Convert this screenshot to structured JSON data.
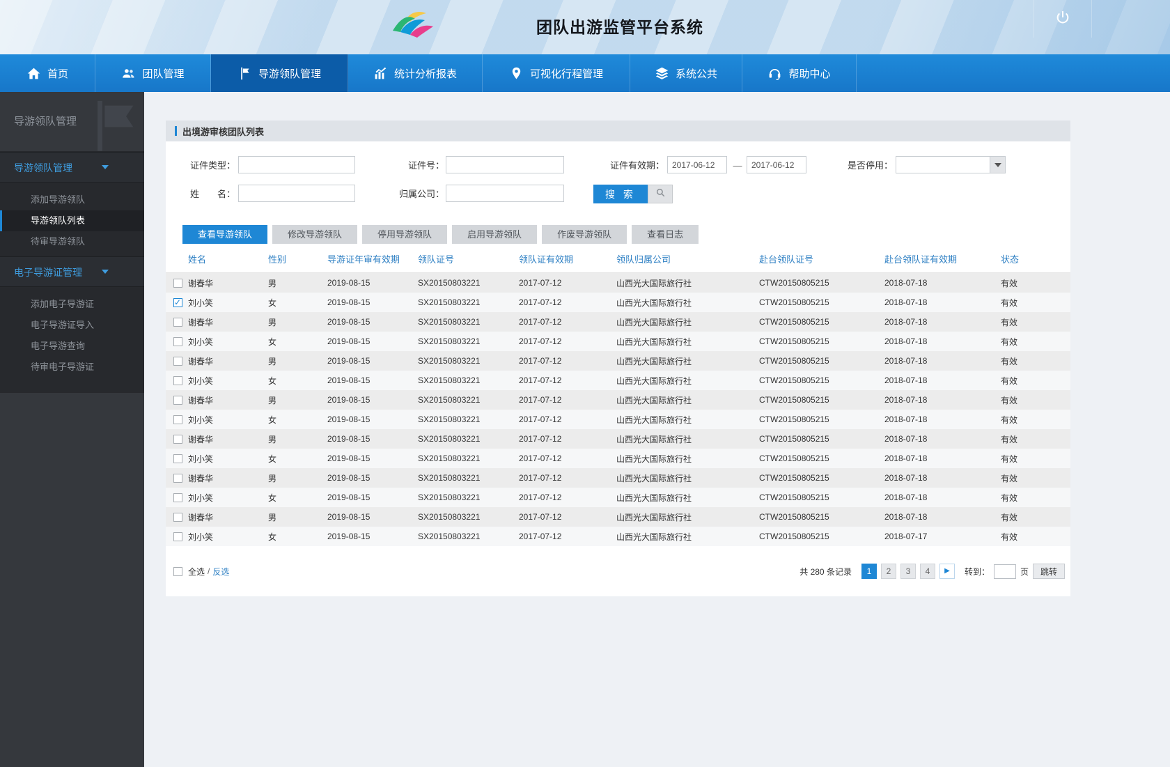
{
  "colors": {
    "accent": "#1e87d5",
    "nav_bg": "#1b80d5",
    "nav_active": "#0c5ca8",
    "sidebar_bg": "#35383d",
    "link": "#2d7fc3"
  },
  "header": {
    "title": "团队出游监管平台系统"
  },
  "nav": {
    "items": [
      {
        "key": "home",
        "label": "首页",
        "icon": "home-icon",
        "active": false
      },
      {
        "key": "team",
        "label": "团队管理",
        "icon": "team-icon",
        "active": false
      },
      {
        "key": "guide-leader",
        "label": "导游领队管理",
        "icon": "flag-icon",
        "active": true
      },
      {
        "key": "stats",
        "label": "统计分析报表",
        "icon": "chart-icon",
        "active": false
      },
      {
        "key": "itinerary",
        "label": "可视化行程管理",
        "icon": "itinerary-icon",
        "active": false
      },
      {
        "key": "system",
        "label": "系统公共",
        "icon": "layers-icon",
        "active": false
      },
      {
        "key": "help",
        "label": "帮助中心",
        "icon": "headset-icon",
        "active": false
      }
    ],
    "power_icon": "power-icon"
  },
  "sidebar": {
    "title": "导游领队管理",
    "groups": [
      {
        "key": "guide-leader-mgmt",
        "label": "导游领队管理",
        "items": [
          {
            "key": "add-guide",
            "label": "添加导游领队",
            "active": false
          },
          {
            "key": "guide-list",
            "label": "导游领队列表",
            "active": true
          },
          {
            "key": "pending-guide",
            "label": "待审导游领队",
            "active": false
          }
        ]
      },
      {
        "key": "ecard-mgmt",
        "label": "电子导游证管理",
        "items": [
          {
            "key": "add-ecard",
            "label": "添加电子导游证",
            "active": false
          },
          {
            "key": "import-ecard",
            "label": "电子导游证导入",
            "active": false
          },
          {
            "key": "query-ecard",
            "label": "电子导游查询",
            "active": false
          },
          {
            "key": "pending-ecard",
            "label": "待审电子导游证",
            "active": false
          }
        ]
      }
    ]
  },
  "panel": {
    "title": "出境游审核团队列表"
  },
  "search": {
    "cert_type_label": "证件类型：",
    "cert_no_label": "证件号：",
    "cert_valid_label": "证件有效期：",
    "date_from": "2017-06-12",
    "date_separator": "—",
    "date_to": "2017-06-12",
    "disabled_label": "是否停用：",
    "name_label": "姓　　名：",
    "company_label": "归属公司：",
    "search_button": "搜 索"
  },
  "tabs": [
    {
      "key": "view",
      "label": "查看导游领队",
      "active": true
    },
    {
      "key": "edit",
      "label": "修改导游领队",
      "active": false
    },
    {
      "key": "disable",
      "label": "停用导游领队",
      "active": false
    },
    {
      "key": "enable",
      "label": "启用导游领队",
      "active": false
    },
    {
      "key": "invalidate",
      "label": "作废导游领队",
      "active": false
    },
    {
      "key": "logs",
      "label": "查看日志",
      "active": false
    }
  ],
  "table": {
    "columns": [
      "姓名",
      "性别",
      "导游证年审有效期",
      "领队证号",
      "领队证有效期",
      "领队归属公司",
      "赴台领队证号",
      "赴台领队证有效期",
      "状态"
    ],
    "rows": [
      {
        "checked": false,
        "name": "谢春华",
        "gender": "男",
        "guide_cert_valid": "2019-08-15",
        "leader_cert_no": "SX20150803221",
        "leader_cert_valid": "2017-07-12",
        "company": "山西光大国际旅行社",
        "taiwan_cert_no": "CTW20150805215",
        "taiwan_cert_valid": "2018-07-18",
        "status": "有效"
      },
      {
        "checked": true,
        "name": "刘小笑",
        "gender": "女",
        "guide_cert_valid": "2019-08-15",
        "leader_cert_no": "SX20150803221",
        "leader_cert_valid": "2017-07-12",
        "company": "山西光大国际旅行社",
        "taiwan_cert_no": "CTW20150805215",
        "taiwan_cert_valid": "2018-07-18",
        "status": "有效"
      },
      {
        "checked": false,
        "name": "谢春华",
        "gender": "男",
        "guide_cert_valid": "2019-08-15",
        "leader_cert_no": "SX20150803221",
        "leader_cert_valid": "2017-07-12",
        "company": "山西光大国际旅行社",
        "taiwan_cert_no": "CTW20150805215",
        "taiwan_cert_valid": "2018-07-18",
        "status": "有效"
      },
      {
        "checked": false,
        "name": "刘小笑",
        "gender": "女",
        "guide_cert_valid": "2019-08-15",
        "leader_cert_no": "SX20150803221",
        "leader_cert_valid": "2017-07-12",
        "company": "山西光大国际旅行社",
        "taiwan_cert_no": "CTW20150805215",
        "taiwan_cert_valid": "2018-07-18",
        "status": "有效"
      },
      {
        "checked": false,
        "name": "谢春华",
        "gender": "男",
        "guide_cert_valid": "2019-08-15",
        "leader_cert_no": "SX20150803221",
        "leader_cert_valid": "2017-07-12",
        "company": "山西光大国际旅行社",
        "taiwan_cert_no": "CTW20150805215",
        "taiwan_cert_valid": "2018-07-18",
        "status": "有效"
      },
      {
        "checked": false,
        "name": "刘小笑",
        "gender": "女",
        "guide_cert_valid": "2019-08-15",
        "leader_cert_no": "SX20150803221",
        "leader_cert_valid": "2017-07-12",
        "company": "山西光大国际旅行社",
        "taiwan_cert_no": "CTW20150805215",
        "taiwan_cert_valid": "2018-07-18",
        "status": "有效"
      },
      {
        "checked": false,
        "name": "谢春华",
        "gender": "男",
        "guide_cert_valid": "2019-08-15",
        "leader_cert_no": "SX20150803221",
        "leader_cert_valid": "2017-07-12",
        "company": "山西光大国际旅行社",
        "taiwan_cert_no": "CTW20150805215",
        "taiwan_cert_valid": "2018-07-18",
        "status": "有效"
      },
      {
        "checked": false,
        "name": "刘小笑",
        "gender": "女",
        "guide_cert_valid": "2019-08-15",
        "leader_cert_no": "SX20150803221",
        "leader_cert_valid": "2017-07-12",
        "company": "山西光大国际旅行社",
        "taiwan_cert_no": "CTW20150805215",
        "taiwan_cert_valid": "2018-07-18",
        "status": "有效"
      },
      {
        "checked": false,
        "name": "谢春华",
        "gender": "男",
        "guide_cert_valid": "2019-08-15",
        "leader_cert_no": "SX20150803221",
        "leader_cert_valid": "2017-07-12",
        "company": "山西光大国际旅行社",
        "taiwan_cert_no": "CTW20150805215",
        "taiwan_cert_valid": "2018-07-18",
        "status": "有效"
      },
      {
        "checked": false,
        "name": "刘小笑",
        "gender": "女",
        "guide_cert_valid": "2019-08-15",
        "leader_cert_no": "SX20150803221",
        "leader_cert_valid": "2017-07-12",
        "company": "山西光大国际旅行社",
        "taiwan_cert_no": "CTW20150805215",
        "taiwan_cert_valid": "2018-07-18",
        "status": "有效"
      },
      {
        "checked": false,
        "name": "谢春华",
        "gender": "男",
        "guide_cert_valid": "2019-08-15",
        "leader_cert_no": "SX20150803221",
        "leader_cert_valid": "2017-07-12",
        "company": "山西光大国际旅行社",
        "taiwan_cert_no": "CTW20150805215",
        "taiwan_cert_valid": "2018-07-18",
        "status": "有效"
      },
      {
        "checked": false,
        "name": "刘小笑",
        "gender": "女",
        "guide_cert_valid": "2019-08-15",
        "leader_cert_no": "SX20150803221",
        "leader_cert_valid": "2017-07-12",
        "company": "山西光大国际旅行社",
        "taiwan_cert_no": "CTW20150805215",
        "taiwan_cert_valid": "2018-07-18",
        "status": "有效"
      },
      {
        "checked": false,
        "name": "谢春华",
        "gender": "男",
        "guide_cert_valid": "2019-08-15",
        "leader_cert_no": "SX20150803221",
        "leader_cert_valid": "2017-07-12",
        "company": "山西光大国际旅行社",
        "taiwan_cert_no": "CTW20150805215",
        "taiwan_cert_valid": "2018-07-18",
        "status": "有效"
      },
      {
        "checked": false,
        "name": "刘小笑",
        "gender": "女",
        "guide_cert_valid": "2019-08-15",
        "leader_cert_no": "SX20150803221",
        "leader_cert_valid": "2017-07-12",
        "company": "山西光大国际旅行社",
        "taiwan_cert_no": "CTW20150805215",
        "taiwan_cert_valid": "2018-07-17",
        "status": "有效"
      }
    ]
  },
  "footer": {
    "select_all": "全选",
    "slash": "/",
    "invert": "反选",
    "total_text": "共 280 条记录",
    "pages": [
      {
        "label": "1",
        "active": true
      },
      {
        "label": "2",
        "active": false
      },
      {
        "label": "3",
        "active": false
      },
      {
        "label": "4",
        "active": false
      }
    ],
    "next_label": "▶",
    "goto_label": "转到：",
    "goto_value": "",
    "page_label": "页",
    "goto_button": "跳转"
  }
}
